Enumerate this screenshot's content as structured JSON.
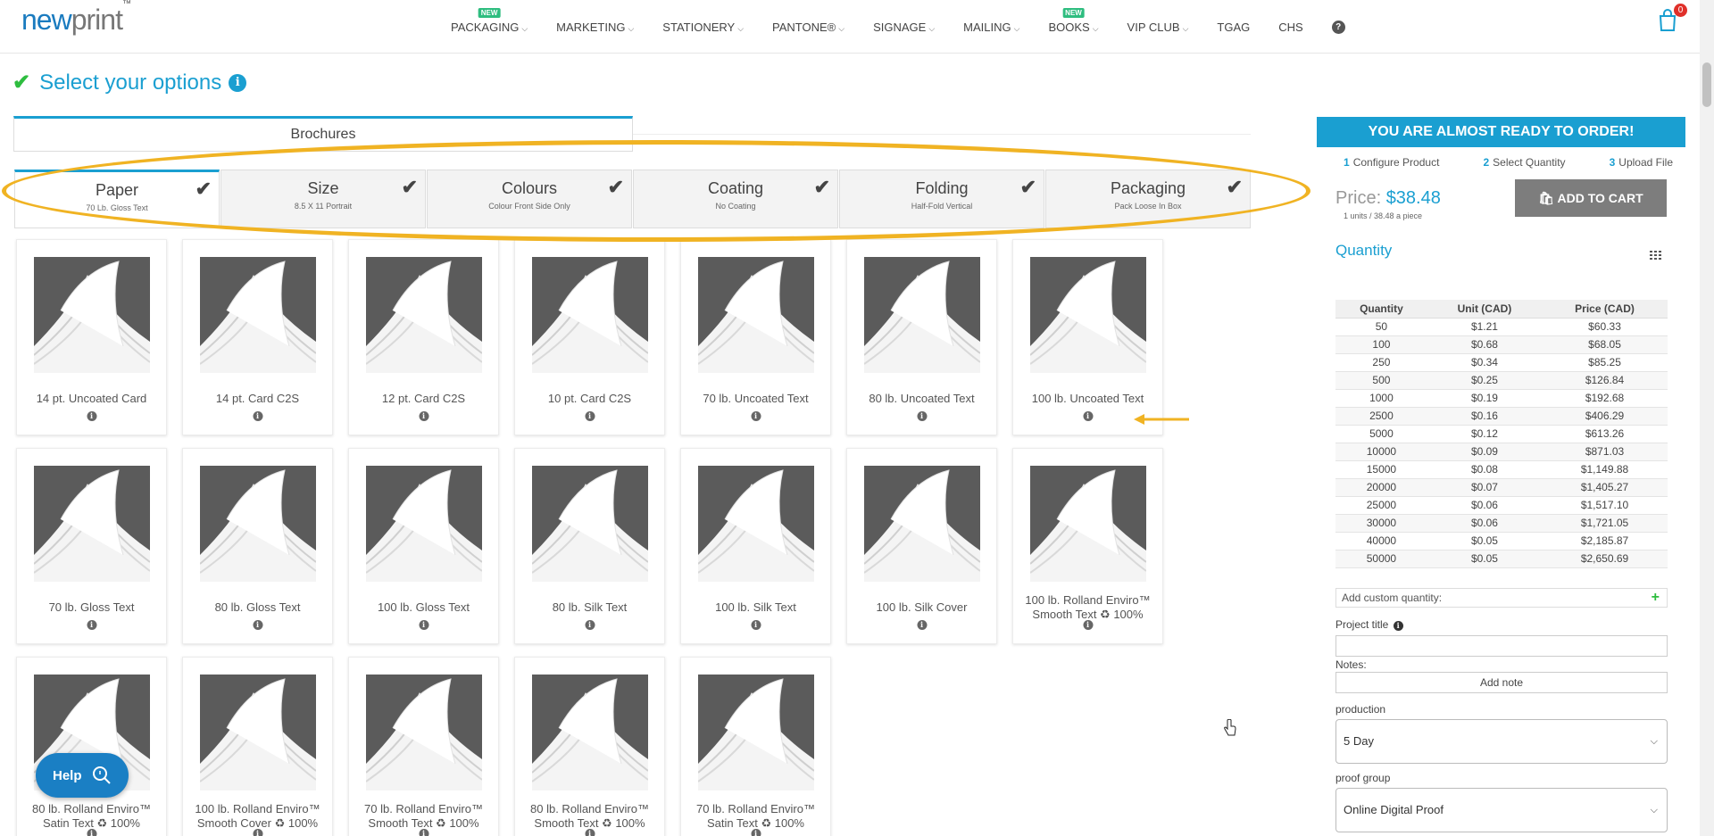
{
  "header": {
    "logo_new": "new",
    "logo_print": "print",
    "logo_tm": "™",
    "nav": [
      {
        "label": "PACKAGING",
        "badge": "NEW"
      },
      {
        "label": "MARKETING"
      },
      {
        "label": "STATIONERY"
      },
      {
        "label": "PANTONE®"
      },
      {
        "label": "SIGNAGE"
      },
      {
        "label": "MAILING"
      },
      {
        "label": "BOOKS",
        "badge": "NEW"
      },
      {
        "label": "VIP CLUB"
      },
      {
        "label": "TGAG"
      },
      {
        "label": "CHS"
      }
    ],
    "help_glyph": "?",
    "cart_count": "0"
  },
  "page": {
    "title": "Select your options",
    "product_tab": "Brochures"
  },
  "options": [
    {
      "name": "Paper",
      "value": "70 Lb. Gloss Text"
    },
    {
      "name": "Size",
      "value": "8.5 X 11 Portrait"
    },
    {
      "name": "Colours",
      "value": "Colour Front Side Only"
    },
    {
      "name": "Coating",
      "value": "No Coating"
    },
    {
      "name": "Folding",
      "value": "Half-Fold Vertical"
    },
    {
      "name": "Packaging",
      "value": "Pack Loose In Box"
    }
  ],
  "papers": [
    "14 pt. Uncoated Card",
    "14 pt. Card C2S",
    "12 pt. Card C2S",
    "10 pt. Card C2S",
    "70 lb. Uncoated Text",
    "80 lb. Uncoated Text",
    "100 lb. Uncoated Text",
    "70 lb. Gloss Text",
    "80 lb. Gloss Text",
    "100 lb. Gloss Text",
    "80 lb. Silk Text",
    "100 lb. Silk Text",
    "100 lb. Silk Cover",
    "100 lb. Rolland Enviro™ Smooth Text ♻ 100%",
    "80 lb. Rolland Enviro™ Satin Text ♻ 100%",
    "100 lb. Rolland Enviro™ Smooth Cover ♻ 100%",
    "70 lb. Rolland Enviro™ Smooth Text ♻ 100%",
    "80 lb. Rolland Enviro™ Smooth Text ♻ 100%",
    "70 lb. Rolland Enviro™ Satin Text ♻ 100%"
  ],
  "help_button": "Help",
  "sidebar": {
    "banner": "YOU ARE ALMOST READY TO ORDER!",
    "steps": [
      {
        "num": "1",
        "label": "Configure Product"
      },
      {
        "num": "2",
        "label": "Select Quantity"
      },
      {
        "num": "3",
        "label": "Upload File"
      }
    ],
    "price_label": "Price:",
    "price_value": "$38.48",
    "price_sub": "1 units / 38.48 a piece",
    "add_to_cart": "ADD TO CART",
    "quantity_title": "Quantity",
    "table_headers": [
      "Quantity",
      "Unit (CAD)",
      "Price (CAD)"
    ],
    "table_rows": [
      [
        "50",
        "$1.21",
        "$60.33"
      ],
      [
        "100",
        "$0.68",
        "$68.05"
      ],
      [
        "250",
        "$0.34",
        "$85.25"
      ],
      [
        "500",
        "$0.25",
        "$126.84"
      ],
      [
        "1000",
        "$0.19",
        "$192.68"
      ],
      [
        "2500",
        "$0.16",
        "$406.29"
      ],
      [
        "5000",
        "$0.12",
        "$613.26"
      ],
      [
        "10000",
        "$0.09",
        "$871.03"
      ],
      [
        "15000",
        "$0.08",
        "$1,149.88"
      ],
      [
        "20000",
        "$0.07",
        "$1,405.27"
      ],
      [
        "25000",
        "$0.06",
        "$1,517.10"
      ],
      [
        "30000",
        "$0.06",
        "$1,721.05"
      ],
      [
        "40000",
        "$0.05",
        "$2,185.87"
      ],
      [
        "50000",
        "$0.05",
        "$2,650.69"
      ]
    ],
    "custom_quantity": "Add custom quantity:",
    "project_title_label": "Project title",
    "notes_label": "Notes:",
    "add_note": "Add note",
    "production_label": "production",
    "production_value": "5 Day",
    "proof_label": "proof group",
    "proof_value": "Online Digital Proof"
  },
  "colors": {
    "accent": "#1a9fd1",
    "annotation": "#f0b323",
    "check": "#2ebd3f"
  }
}
